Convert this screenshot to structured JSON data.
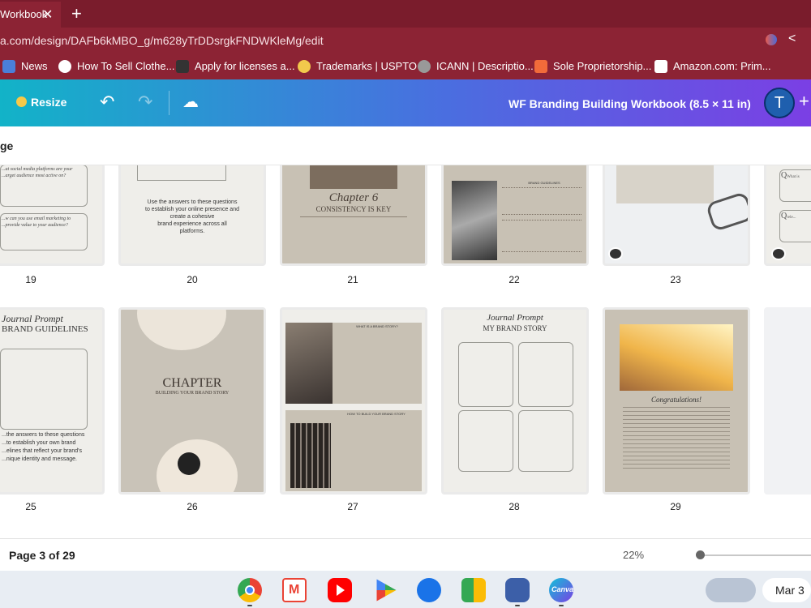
{
  "browser": {
    "tab_title": "Workbook",
    "url": "a.com/design/DAFb6kMBO_g/m628yTrDDsrgkFNDWKleMg/edit",
    "bookmarks": [
      "News",
      "How To Sell Clothe...",
      "Apply for licenses a...",
      "Trademarks | USPTO",
      "ICANN | Descriptio...",
      "Sole Proprietorship...",
      "Amazon.com: Prim..."
    ]
  },
  "toolbar": {
    "resize_label": "Resize",
    "doc_title": "WF Branding Building Workbook (8.5 × 11 in)",
    "avatar_initial": "T"
  },
  "subheader": {
    "label": "ge"
  },
  "pages_row1": [
    {
      "num": "19",
      "text": [
        "...at social media platforms are your",
        "...arget audience most active on?",
        "...w can you use email marketing to",
        "...provide value to your audience?"
      ]
    },
    {
      "num": "20",
      "text": [
        "Use the answers to these questions",
        "to establish your online presence and",
        "create a cohesive",
        "brand experience across all",
        "platforms."
      ]
    },
    {
      "num": "21",
      "title": "Chapter 6",
      "subtitle": "CONSISTENCY IS KEY"
    },
    {
      "num": "22",
      "heading": "BRAND GUIDELINES"
    },
    {
      "num": "23"
    },
    {
      "num": "",
      "text": [
        "What is",
        "rele..."
      ]
    }
  ],
  "pages_row2": [
    {
      "num": "25",
      "title": "Journal Prompt",
      "subtitle": "BRAND GUIDELINES",
      "text": [
        "...the answers to these questions",
        "...to establish your own brand",
        "...elines that reflect your brand's",
        "...nique identity and message."
      ]
    },
    {
      "num": "26",
      "title": "CHAPTER",
      "subtitle": "BUILDING YOUR BRAND STORY"
    },
    {
      "num": "27",
      "heading": "WHAT IS A BRAND STORY?",
      "heading2": "HOW TO BUILD YOUR BRAND STORY"
    },
    {
      "num": "28",
      "title": "Journal Prompt",
      "subtitle": "MY BRAND STORY"
    },
    {
      "num": "29",
      "heading": "Congratulations!"
    }
  ],
  "footer": {
    "page_info": "Page 3 of 29",
    "zoom": "22%",
    "zoom_fraction": 0.02
  },
  "shelf": {
    "date": "Mar 3",
    "apps": [
      "chrome-icon",
      "gmail-icon",
      "youtube-icon",
      "play-store-icon",
      "messages-icon",
      "meet-icon",
      "photos-icon",
      "canva-icon"
    ]
  }
}
